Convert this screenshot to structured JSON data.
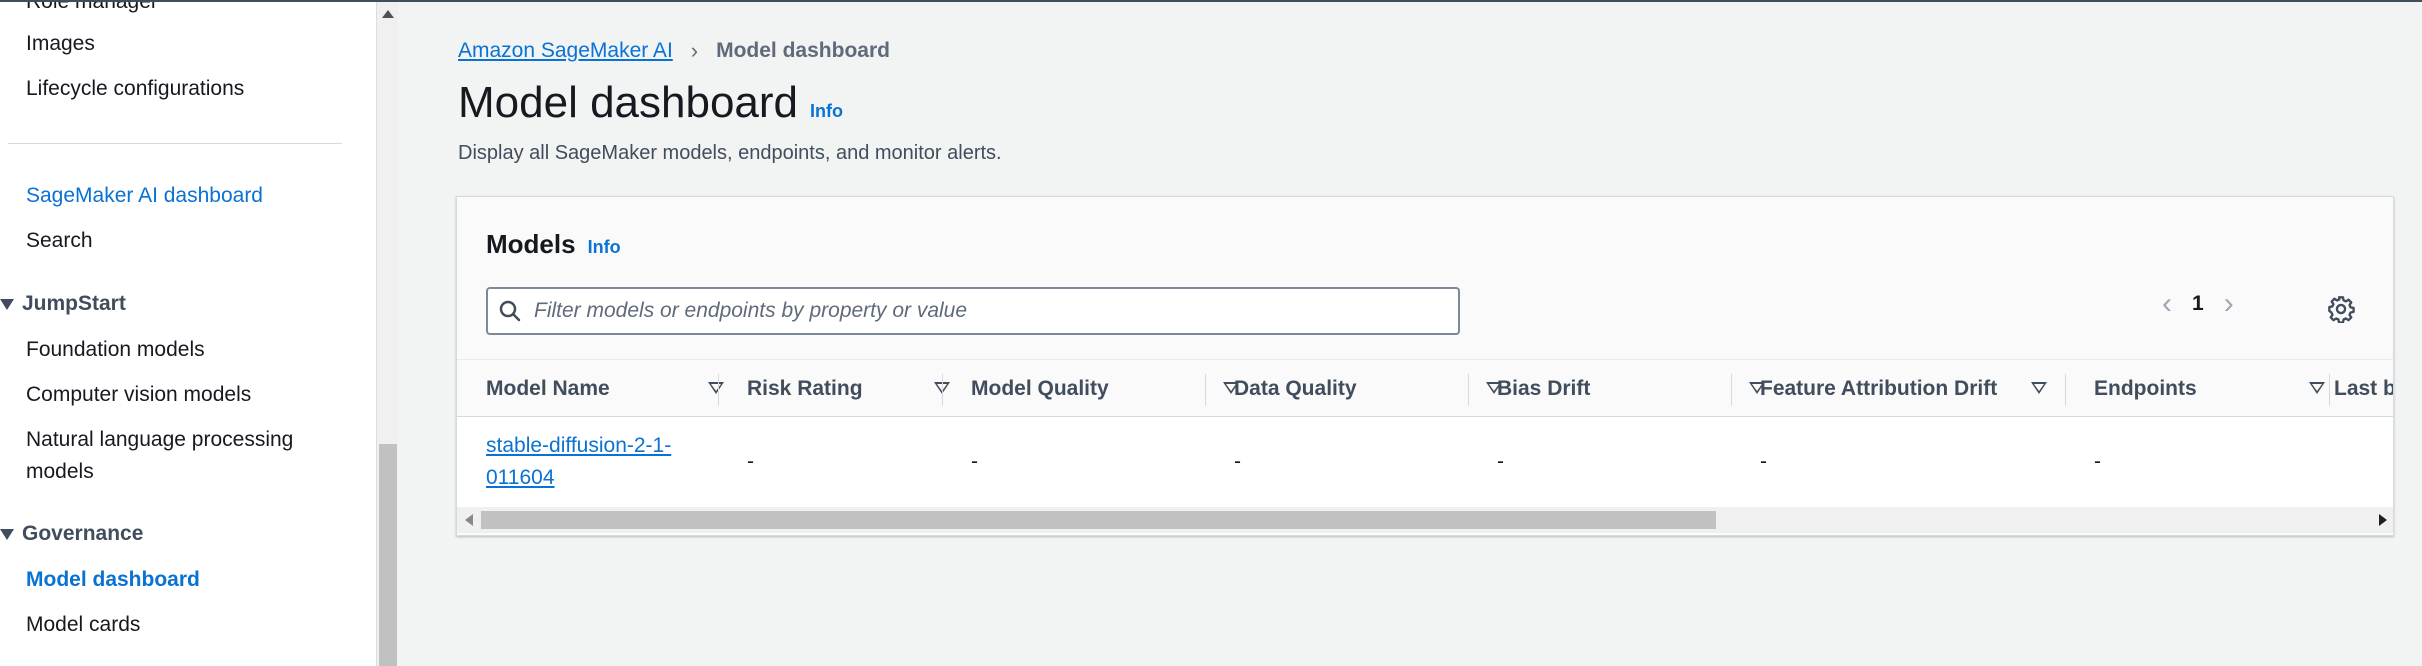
{
  "sidebar": {
    "items": [
      {
        "label": "Role manager"
      },
      {
        "label": "Images"
      },
      {
        "label": "Lifecycle configurations"
      },
      {
        "label": "SageMaker AI dashboard"
      },
      {
        "label": "Search"
      }
    ],
    "sections": [
      {
        "label": "JumpStart",
        "items": [
          "Foundation models",
          "Computer vision models",
          "Natural language processing",
          "models"
        ]
      },
      {
        "label": "Governance",
        "items": [
          "Model dashboard",
          "Model cards"
        ]
      }
    ]
  },
  "breadcrumb": {
    "parent": "Amazon SageMaker AI",
    "separator": "›",
    "current": "Model dashboard"
  },
  "page": {
    "title": "Model dashboard",
    "info": "Info",
    "description": "Display all SageMaker models, endpoints, and monitor alerts."
  },
  "models": {
    "title": "Models",
    "info": "Info",
    "filter_placeholder": "Filter models or endpoints by property or value",
    "page_number": "1",
    "prev_icon": "chevron-left-icon",
    "next_icon": "chevron-right-icon",
    "settings_icon": "gear-icon",
    "columns": [
      "Model Name",
      "Risk Rating",
      "Model Quality",
      "Data Quality",
      "Bias Drift",
      "Feature Attribution Drift",
      "Endpoints",
      "Last b"
    ],
    "rows": [
      {
        "name_line1": "stable-diffusion-2-1-",
        "name_line2": "011604",
        "risk_rating": "-",
        "model_quality": "-",
        "data_quality": "-",
        "bias_drift": "-",
        "feature_attribution_drift": "-",
        "endpoints": "-"
      }
    ]
  },
  "colors": {
    "link": "#0972d3",
    "background": "#f2f3f3",
    "text": "#16191f"
  }
}
